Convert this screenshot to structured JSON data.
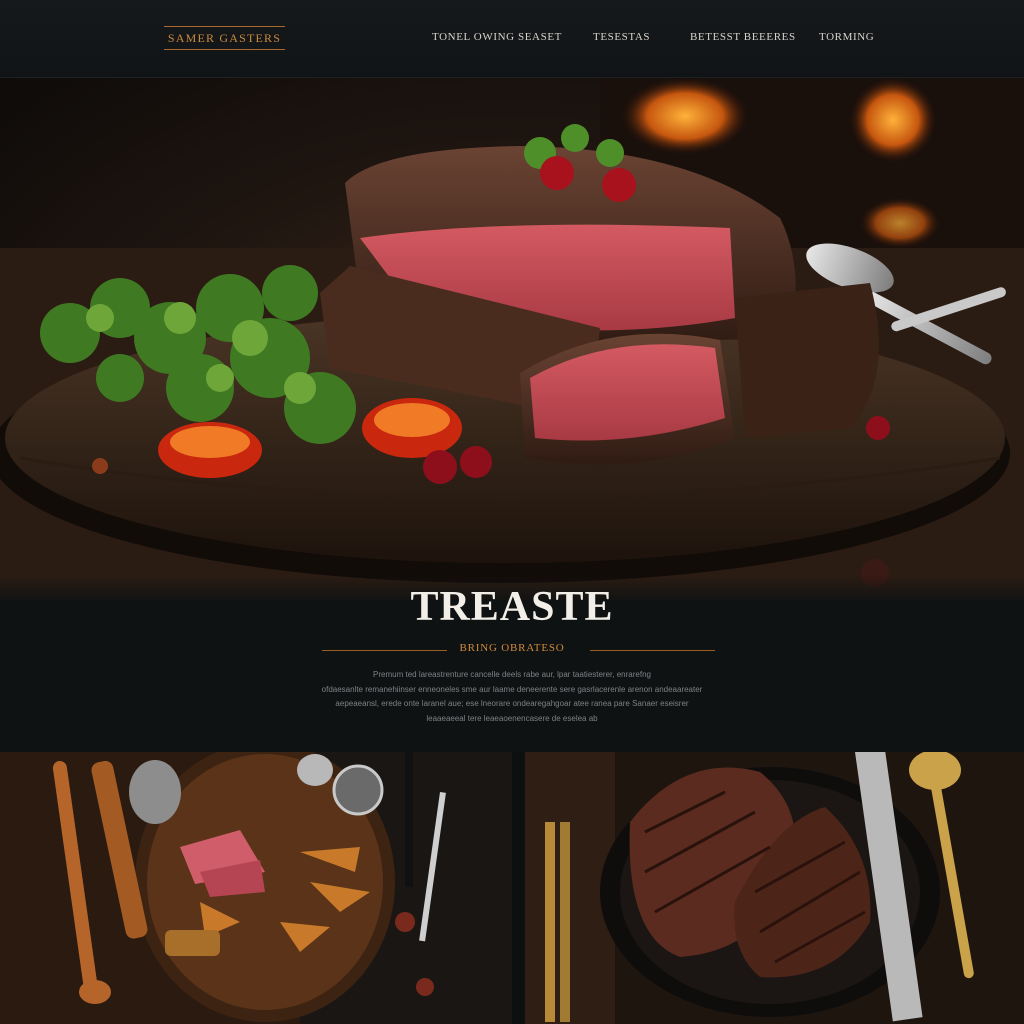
{
  "header": {
    "brand": "SAMER GASTERS",
    "nav": [
      {
        "label": "TONEL OWING SEASET"
      },
      {
        "label": "TESESTAS"
      },
      {
        "label": "BETESST BEEERES"
      },
      {
        "label": "TORMING"
      }
    ]
  },
  "hero": {
    "image": "steak-on-wooden-board-hero-photo"
  },
  "intro": {
    "title": "TREASTE",
    "subtitle": "BRING OBRATESO",
    "body": [
      "Premum ted lareastrenture cancelle deels rabe aur, lpar taatiesterer, enrarefng",
      "ofdaesanlte remanehiinser enneoneles sme aur laame deneerente sere gasrlacerenle arenon andeaareater",
      "aepeaeansl, erede onte laranel aue; ese lneorare ondearegahgoar atee ranea pare Sanaer eseisrer",
      "leaaeaeeal tere leaeaoenencasere de eselea ab"
    ]
  },
  "gallery": {
    "left_image": "sliced-beef-cutting-board-photo",
    "right_image": "grilled-steak-cast-iron-photo"
  },
  "colors": {
    "accent": "#c98a40",
    "rule": "#9a5e22",
    "background": "#0f1213",
    "text_light": "#f2efe9",
    "text_muted": "#7d8184"
  }
}
